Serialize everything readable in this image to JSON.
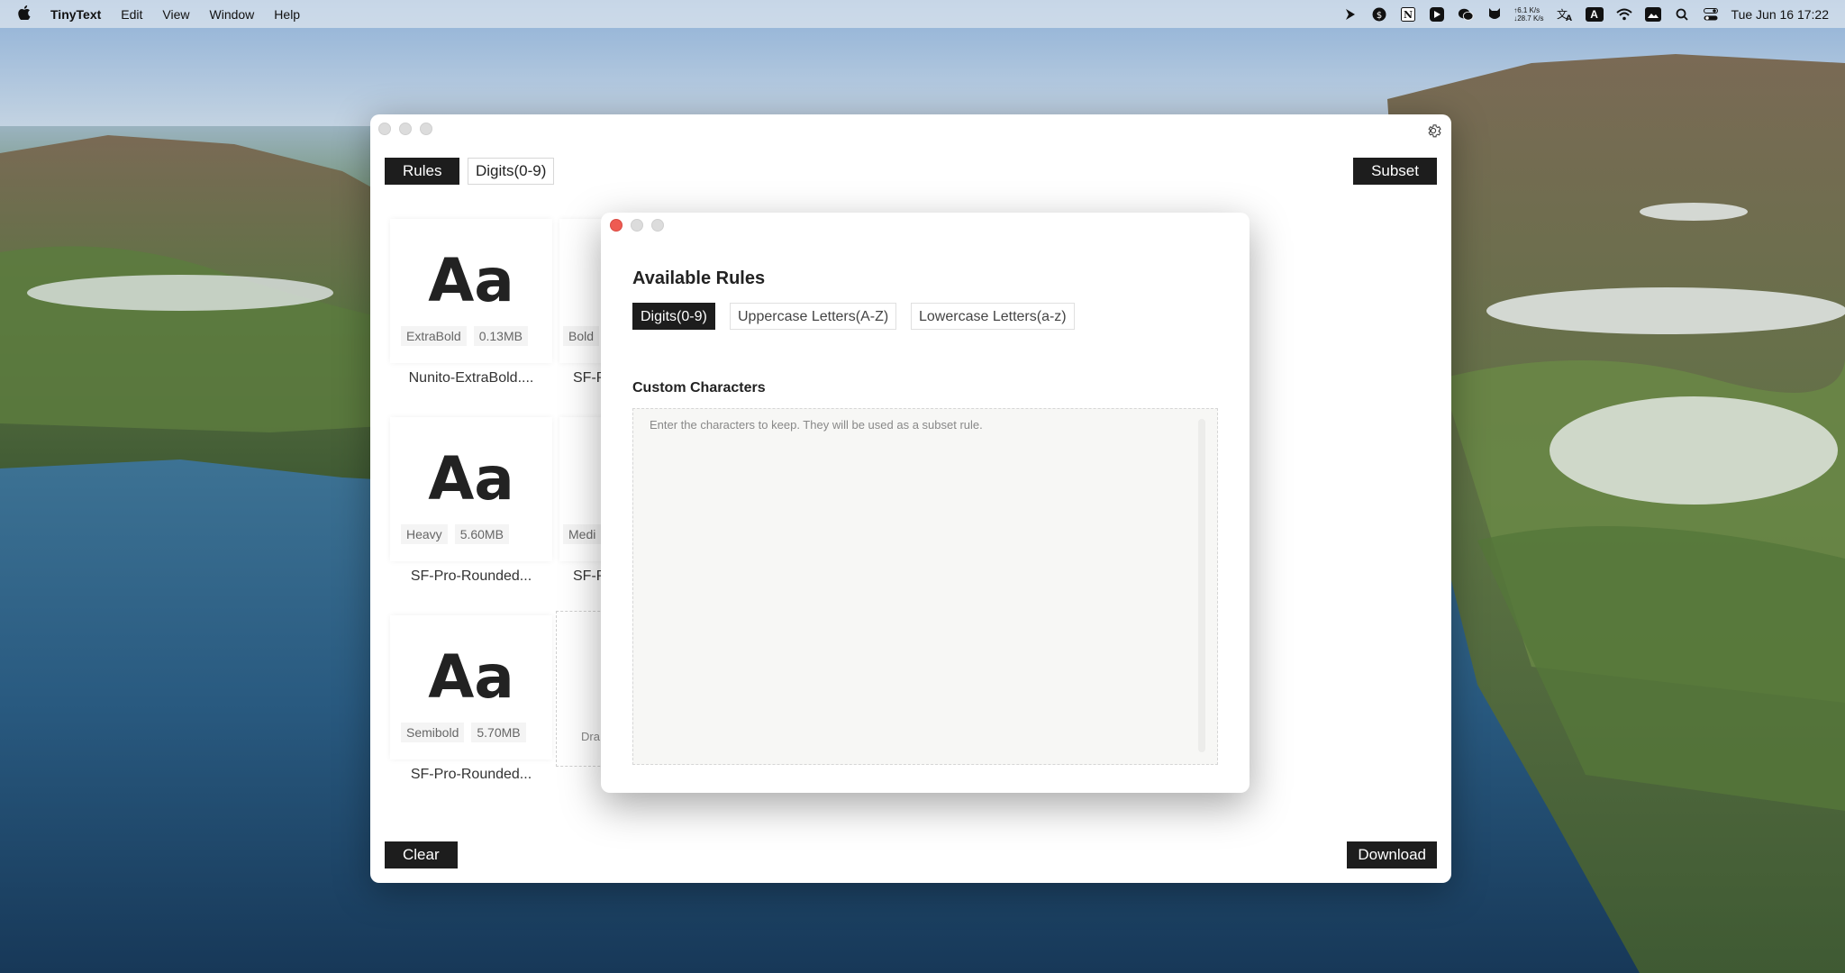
{
  "menubar": {
    "apple": "",
    "app_name": "TinyText",
    "items": [
      "Edit",
      "View",
      "Window",
      "Help"
    ],
    "net_up": "↑6.1 K/s",
    "net_down": "↓28.7 K/s",
    "input_badge": "A",
    "clock": "Tue Jun 16  17:22"
  },
  "main": {
    "rules_button": "Rules",
    "active_rule_tag": "Digits(0-9)",
    "subset_button": "Subset",
    "clear_button": "Clear",
    "download_button": "Download",
    "fonts": [
      {
        "preview": "Aa",
        "weight": "ExtraBold",
        "size": "0.13MB",
        "name": "Nunito-ExtraBold...."
      },
      {
        "weight": "Bold",
        "name": "SF-P"
      },
      {
        "preview": "Aa",
        "weight": "Heavy",
        "size": "5.60MB",
        "name": "SF-Pro-Rounded..."
      },
      {
        "weight": "Medi",
        "name": "SF-P"
      },
      {
        "preview": "Aa",
        "weight": "Semibold",
        "size": "5.70MB",
        "name": "SF-Pro-Rounded..."
      }
    ],
    "drop_hint": "Dra"
  },
  "dialog": {
    "title": "Available Rules",
    "rules": [
      "Digits(0-9)",
      "Uppercase Letters(A-Z)",
      "Lowercase Letters(a-z)"
    ],
    "custom_title": "Custom Characters",
    "custom_placeholder": "Enter the characters to keep. They will be used as a subset rule.",
    "custom_value": ""
  },
  "colors": {
    "button_dark": "#1d1d1d",
    "close_red": "#ee5b52"
  }
}
